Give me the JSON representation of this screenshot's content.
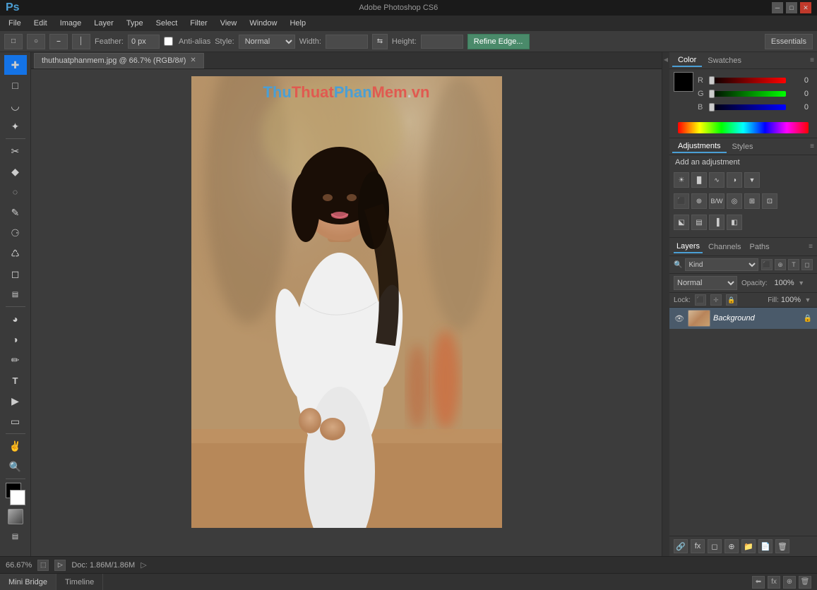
{
  "title_bar": {
    "logo": "Ps",
    "win_title": "Adobe Photoshop CS6",
    "min_btn": "─",
    "max_btn": "□",
    "close_btn": "✕"
  },
  "menu_bar": {
    "items": [
      "File",
      "Edit",
      "Image",
      "Layer",
      "Type",
      "Select",
      "Filter",
      "View",
      "Window",
      "Help"
    ]
  },
  "options_bar": {
    "feather_label": "Feather:",
    "feather_value": "0 px",
    "antialias_label": "Anti-alias",
    "style_label": "Style:",
    "style_value": "Normal",
    "width_label": "Width:",
    "height_label": "Height:",
    "refine_edge_btn": "Refine Edge...",
    "essentials_btn": "Essentials"
  },
  "document": {
    "tab_label": "thuthuatphanmem.jpg @ 66.7% (RGB/8#)"
  },
  "watermark": {
    "thu": "Thu",
    "thuat": "Thuat",
    "phan": "Phan",
    "mem": "Mem",
    "dot": ".",
    "vn": "vn"
  },
  "color_panel": {
    "tab1": "Color",
    "tab2": "Swatches",
    "r_label": "R",
    "r_value": "0",
    "g_label": "G",
    "g_value": "0",
    "b_label": "B",
    "b_value": "0"
  },
  "adjustments_panel": {
    "tab1": "Adjustments",
    "tab2": "Styles",
    "title": "Add an adjustment"
  },
  "layers_panel": {
    "tab1": "Layers",
    "tab2": "Channels",
    "tab3": "Paths",
    "kind_label": "Kind",
    "blend_mode": "Normal",
    "opacity_label": "Opacity:",
    "opacity_value": "100%",
    "lock_label": "Lock:",
    "fill_label": "Fill:",
    "fill_value": "100%",
    "background_layer": "Background"
  },
  "status_bar": {
    "zoom": "66.67%",
    "doc_info": "Doc: 1.86M/1.86M"
  },
  "bottom_panel": {
    "bridge_label": "Mini Bridge",
    "timeline_label": "Timeline"
  }
}
